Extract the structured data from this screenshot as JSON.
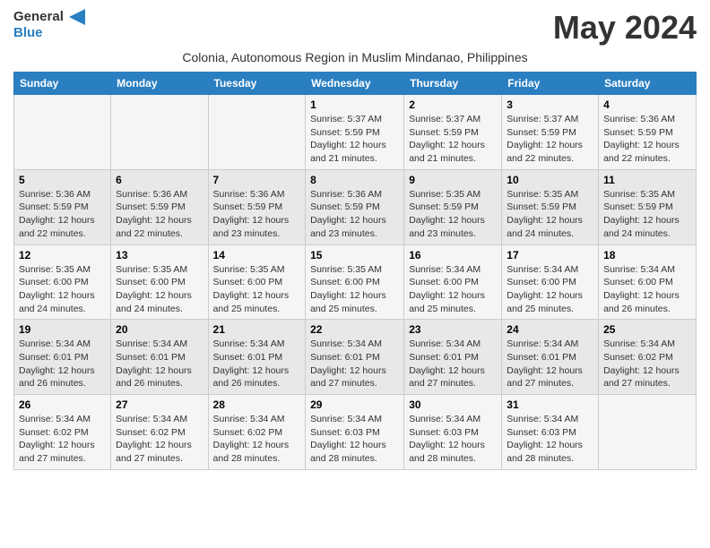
{
  "logo": {
    "line1": "General",
    "line2": "Blue",
    "icon_color": "#2a7fc1"
  },
  "title": "May 2024",
  "subtitle": "Colonia, Autonomous Region in Muslim Mindanao, Philippines",
  "days_of_week": [
    "Sunday",
    "Monday",
    "Tuesday",
    "Wednesday",
    "Thursday",
    "Friday",
    "Saturday"
  ],
  "weeks": [
    [
      {
        "day": "",
        "info": ""
      },
      {
        "day": "",
        "info": ""
      },
      {
        "day": "",
        "info": ""
      },
      {
        "day": "1",
        "info": "Sunrise: 5:37 AM\nSunset: 5:59 PM\nDaylight: 12 hours and 21 minutes."
      },
      {
        "day": "2",
        "info": "Sunrise: 5:37 AM\nSunset: 5:59 PM\nDaylight: 12 hours and 21 minutes."
      },
      {
        "day": "3",
        "info": "Sunrise: 5:37 AM\nSunset: 5:59 PM\nDaylight: 12 hours and 22 minutes."
      },
      {
        "day": "4",
        "info": "Sunrise: 5:36 AM\nSunset: 5:59 PM\nDaylight: 12 hours and 22 minutes."
      }
    ],
    [
      {
        "day": "5",
        "info": "Sunrise: 5:36 AM\nSunset: 5:59 PM\nDaylight: 12 hours and 22 minutes."
      },
      {
        "day": "6",
        "info": "Sunrise: 5:36 AM\nSunset: 5:59 PM\nDaylight: 12 hours and 22 minutes."
      },
      {
        "day": "7",
        "info": "Sunrise: 5:36 AM\nSunset: 5:59 PM\nDaylight: 12 hours and 23 minutes."
      },
      {
        "day": "8",
        "info": "Sunrise: 5:36 AM\nSunset: 5:59 PM\nDaylight: 12 hours and 23 minutes."
      },
      {
        "day": "9",
        "info": "Sunrise: 5:35 AM\nSunset: 5:59 PM\nDaylight: 12 hours and 23 minutes."
      },
      {
        "day": "10",
        "info": "Sunrise: 5:35 AM\nSunset: 5:59 PM\nDaylight: 12 hours and 24 minutes."
      },
      {
        "day": "11",
        "info": "Sunrise: 5:35 AM\nSunset: 5:59 PM\nDaylight: 12 hours and 24 minutes."
      }
    ],
    [
      {
        "day": "12",
        "info": "Sunrise: 5:35 AM\nSunset: 6:00 PM\nDaylight: 12 hours and 24 minutes."
      },
      {
        "day": "13",
        "info": "Sunrise: 5:35 AM\nSunset: 6:00 PM\nDaylight: 12 hours and 24 minutes."
      },
      {
        "day": "14",
        "info": "Sunrise: 5:35 AM\nSunset: 6:00 PM\nDaylight: 12 hours and 25 minutes."
      },
      {
        "day": "15",
        "info": "Sunrise: 5:35 AM\nSunset: 6:00 PM\nDaylight: 12 hours and 25 minutes."
      },
      {
        "day": "16",
        "info": "Sunrise: 5:34 AM\nSunset: 6:00 PM\nDaylight: 12 hours and 25 minutes."
      },
      {
        "day": "17",
        "info": "Sunrise: 5:34 AM\nSunset: 6:00 PM\nDaylight: 12 hours and 25 minutes."
      },
      {
        "day": "18",
        "info": "Sunrise: 5:34 AM\nSunset: 6:00 PM\nDaylight: 12 hours and 26 minutes."
      }
    ],
    [
      {
        "day": "19",
        "info": "Sunrise: 5:34 AM\nSunset: 6:01 PM\nDaylight: 12 hours and 26 minutes."
      },
      {
        "day": "20",
        "info": "Sunrise: 5:34 AM\nSunset: 6:01 PM\nDaylight: 12 hours and 26 minutes."
      },
      {
        "day": "21",
        "info": "Sunrise: 5:34 AM\nSunset: 6:01 PM\nDaylight: 12 hours and 26 minutes."
      },
      {
        "day": "22",
        "info": "Sunrise: 5:34 AM\nSunset: 6:01 PM\nDaylight: 12 hours and 27 minutes."
      },
      {
        "day": "23",
        "info": "Sunrise: 5:34 AM\nSunset: 6:01 PM\nDaylight: 12 hours and 27 minutes."
      },
      {
        "day": "24",
        "info": "Sunrise: 5:34 AM\nSunset: 6:01 PM\nDaylight: 12 hours and 27 minutes."
      },
      {
        "day": "25",
        "info": "Sunrise: 5:34 AM\nSunset: 6:02 PM\nDaylight: 12 hours and 27 minutes."
      }
    ],
    [
      {
        "day": "26",
        "info": "Sunrise: 5:34 AM\nSunset: 6:02 PM\nDaylight: 12 hours and 27 minutes."
      },
      {
        "day": "27",
        "info": "Sunrise: 5:34 AM\nSunset: 6:02 PM\nDaylight: 12 hours and 27 minutes."
      },
      {
        "day": "28",
        "info": "Sunrise: 5:34 AM\nSunset: 6:02 PM\nDaylight: 12 hours and 28 minutes."
      },
      {
        "day": "29",
        "info": "Sunrise: 5:34 AM\nSunset: 6:03 PM\nDaylight: 12 hours and 28 minutes."
      },
      {
        "day": "30",
        "info": "Sunrise: 5:34 AM\nSunset: 6:03 PM\nDaylight: 12 hours and 28 minutes."
      },
      {
        "day": "31",
        "info": "Sunrise: 5:34 AM\nSunset: 6:03 PM\nDaylight: 12 hours and 28 minutes."
      },
      {
        "day": "",
        "info": ""
      }
    ]
  ]
}
